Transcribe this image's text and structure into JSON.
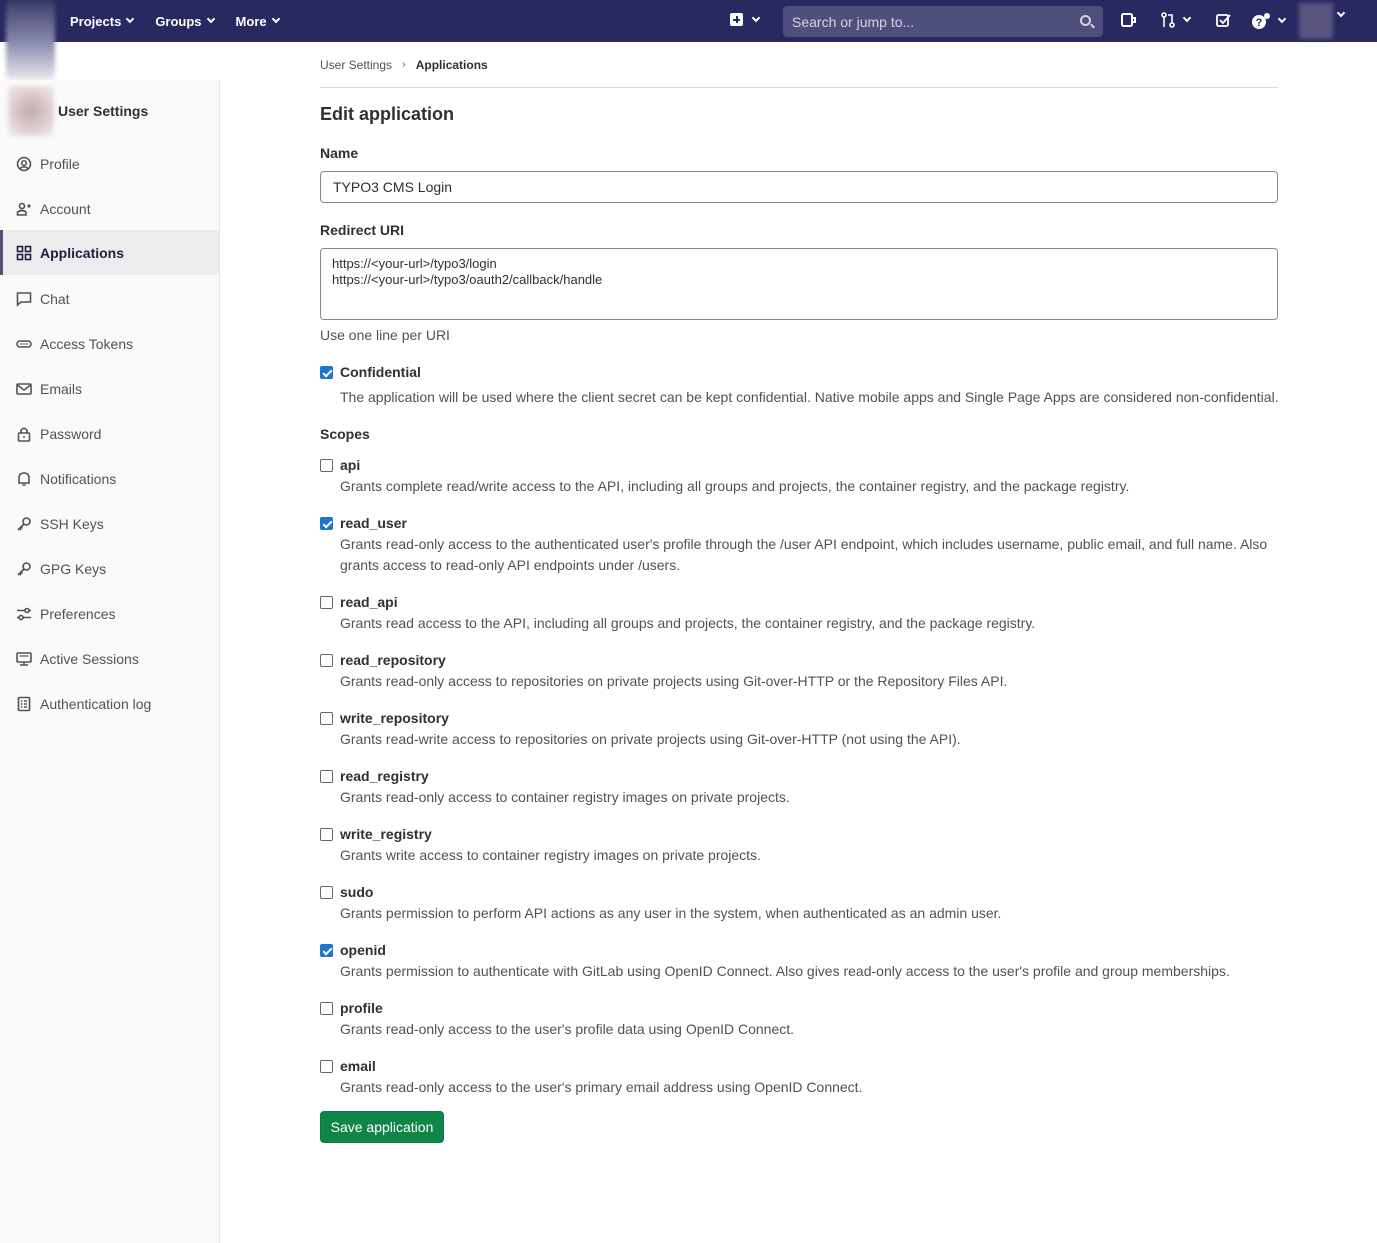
{
  "navbar": {
    "menu": [
      "Projects",
      "Groups",
      "More"
    ],
    "search_placeholder": "Search or jump to..."
  },
  "sidebar": {
    "title": "User Settings",
    "items": [
      {
        "label": "Profile",
        "icon": "profile-icon"
      },
      {
        "label": "Account",
        "icon": "account-icon"
      },
      {
        "label": "Applications",
        "icon": "applications-icon",
        "active": true
      },
      {
        "label": "Chat",
        "icon": "chat-icon"
      },
      {
        "label": "Access Tokens",
        "icon": "token-icon"
      },
      {
        "label": "Emails",
        "icon": "mail-icon"
      },
      {
        "label": "Password",
        "icon": "lock-icon"
      },
      {
        "label": "Notifications",
        "icon": "bell-icon"
      },
      {
        "label": "SSH Keys",
        "icon": "key-icon"
      },
      {
        "label": "GPG Keys",
        "icon": "key-icon"
      },
      {
        "label": "Preferences",
        "icon": "preferences-icon"
      },
      {
        "label": "Active Sessions",
        "icon": "monitor-icon"
      },
      {
        "label": "Authentication log",
        "icon": "log-icon"
      }
    ]
  },
  "breadcrumb": {
    "parent": "User Settings",
    "current": "Applications"
  },
  "form": {
    "title": "Edit application",
    "name_label": "Name",
    "name_value": "TYPO3 CMS Login",
    "redirect_label": "Redirect URI",
    "redirect_value": "https://<your-url>/typo3/login\nhttps://<your-url>/typo3/oauth2/callback/handle",
    "redirect_help": "Use one line per URI",
    "confidential_label": "Confidential",
    "confidential_checked": true,
    "confidential_help": "The application will be used where the client secret can be kept confidential. Native mobile apps and Single Page Apps are considered non-confidential.",
    "scopes_label": "Scopes",
    "scopes": [
      {
        "name": "api",
        "checked": false,
        "desc": "Grants complete read/write access to the API, including all groups and projects, the container registry, and the package registry."
      },
      {
        "name": "read_user",
        "checked": true,
        "desc": "Grants read-only access to the authenticated user's profile through the /user API endpoint, which includes username, public email, and full name. Also grants access to read-only API endpoints under /users."
      },
      {
        "name": "read_api",
        "checked": false,
        "desc": "Grants read access to the API, including all groups and projects, the container registry, and the package registry."
      },
      {
        "name": "read_repository",
        "checked": false,
        "desc": "Grants read-only access to repositories on private projects using Git-over-HTTP or the Repository Files API."
      },
      {
        "name": "write_repository",
        "checked": false,
        "desc": "Grants read-write access to repositories on private projects using Git-over-HTTP (not using the API)."
      },
      {
        "name": "read_registry",
        "checked": false,
        "desc": "Grants read-only access to container registry images on private projects."
      },
      {
        "name": "write_registry",
        "checked": false,
        "desc": "Grants write access to container registry images on private projects."
      },
      {
        "name": "sudo",
        "checked": false,
        "desc": "Grants permission to perform API actions as any user in the system, when authenticated as an admin user."
      },
      {
        "name": "openid",
        "checked": true,
        "desc": "Grants permission to authenticate with GitLab using OpenID Connect. Also gives read-only access to the user's profile and group memberships."
      },
      {
        "name": "profile",
        "checked": false,
        "desc": "Grants read-only access to the user's profile data using OpenID Connect."
      },
      {
        "name": "email",
        "checked": false,
        "desc": "Grants read-only access to the user's primary email address using OpenID Connect."
      }
    ],
    "save_label": "Save application"
  },
  "colors": {
    "navbar": "#292961",
    "save_button": "#108548",
    "checkbox_checked": "#1f75cb"
  }
}
